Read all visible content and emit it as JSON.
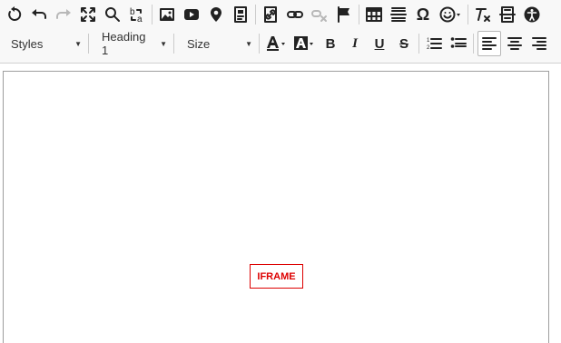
{
  "toolbar": {
    "row1": [
      {
        "name": "reload-icon"
      },
      {
        "name": "undo-icon"
      },
      {
        "name": "redo-icon"
      },
      {
        "name": "fullscreen-icon"
      },
      {
        "name": "search-icon"
      },
      {
        "name": "find-replace-icon"
      },
      {
        "name": "image-icon"
      },
      {
        "name": "youtube-icon"
      },
      {
        "name": "map-pin-icon"
      },
      {
        "name": "template-icon"
      },
      {
        "name": "link-icon"
      },
      {
        "name": "chain-link-icon"
      },
      {
        "name": "unlink-icon"
      },
      {
        "name": "anchor-flag-icon"
      },
      {
        "name": "table-icon"
      },
      {
        "name": "horizontal-rule-icon"
      },
      {
        "name": "special-char-icon"
      },
      {
        "name": "emoji-icon"
      },
      {
        "name": "clear-format-icon"
      },
      {
        "name": "page-break-icon"
      },
      {
        "name": "accessibility-icon"
      }
    ],
    "styles_label": "Styles",
    "heading_label": "Heading 1",
    "size_label": "Size",
    "special_char_glyph": "Ω",
    "replace_glyph": "ba"
  },
  "editor": {
    "iframe_placeholder": "IFRAME"
  },
  "colors": {
    "toolbar_bg": "#f8f8f8",
    "placeholder_red": "#dd0000",
    "icon": "#222222",
    "disabled_icon": "#b8b8b8"
  }
}
